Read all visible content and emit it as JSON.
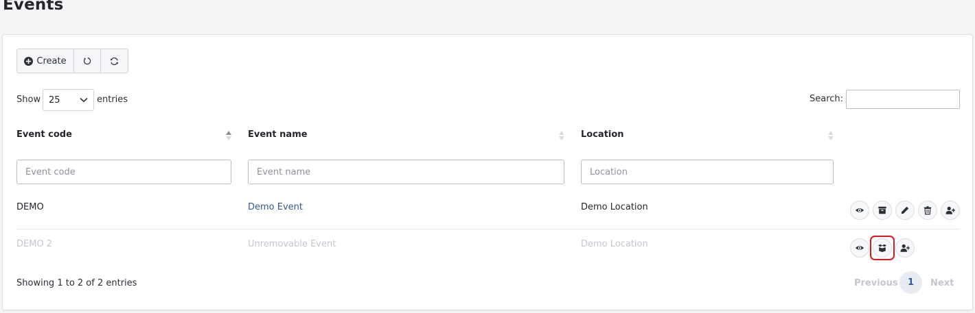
{
  "page": {
    "title": "Events"
  },
  "toolbar": {
    "create_label": "Create",
    "reset_icon": "undo-icon",
    "reload_icon": "refresh-icon"
  },
  "length": {
    "show_label": "Show",
    "value": "25",
    "entries_label": "entries"
  },
  "search": {
    "label": "Search:",
    "value": ""
  },
  "table": {
    "columns": [
      {
        "label": "Event code",
        "placeholder": "Event code"
      },
      {
        "label": "Event name",
        "placeholder": "Event name"
      },
      {
        "label": "Location",
        "placeholder": "Location"
      }
    ],
    "rows": [
      {
        "code": "DEMO",
        "name": "Demo Event",
        "location": "Demo Location",
        "actions": [
          "eye-icon",
          "archive-icon",
          "pencil-icon",
          "trash-icon",
          "user-plus-icon"
        ],
        "muted": false
      },
      {
        "code": "DEMO 2",
        "name": "Unremovable Event",
        "location": "Demo Location",
        "actions": [
          "eye-icon",
          "unarchive-icon",
          "user-plus-icon"
        ],
        "muted": true
      }
    ]
  },
  "footer": {
    "info": "Showing 1 to 2 of 2 entries"
  },
  "pagination": {
    "previous": "Previous",
    "current": "1",
    "next": "Next"
  },
  "colors": {
    "link": "#2f5a92",
    "muted": "#c3c7cd",
    "highlight": "#e0141b"
  }
}
